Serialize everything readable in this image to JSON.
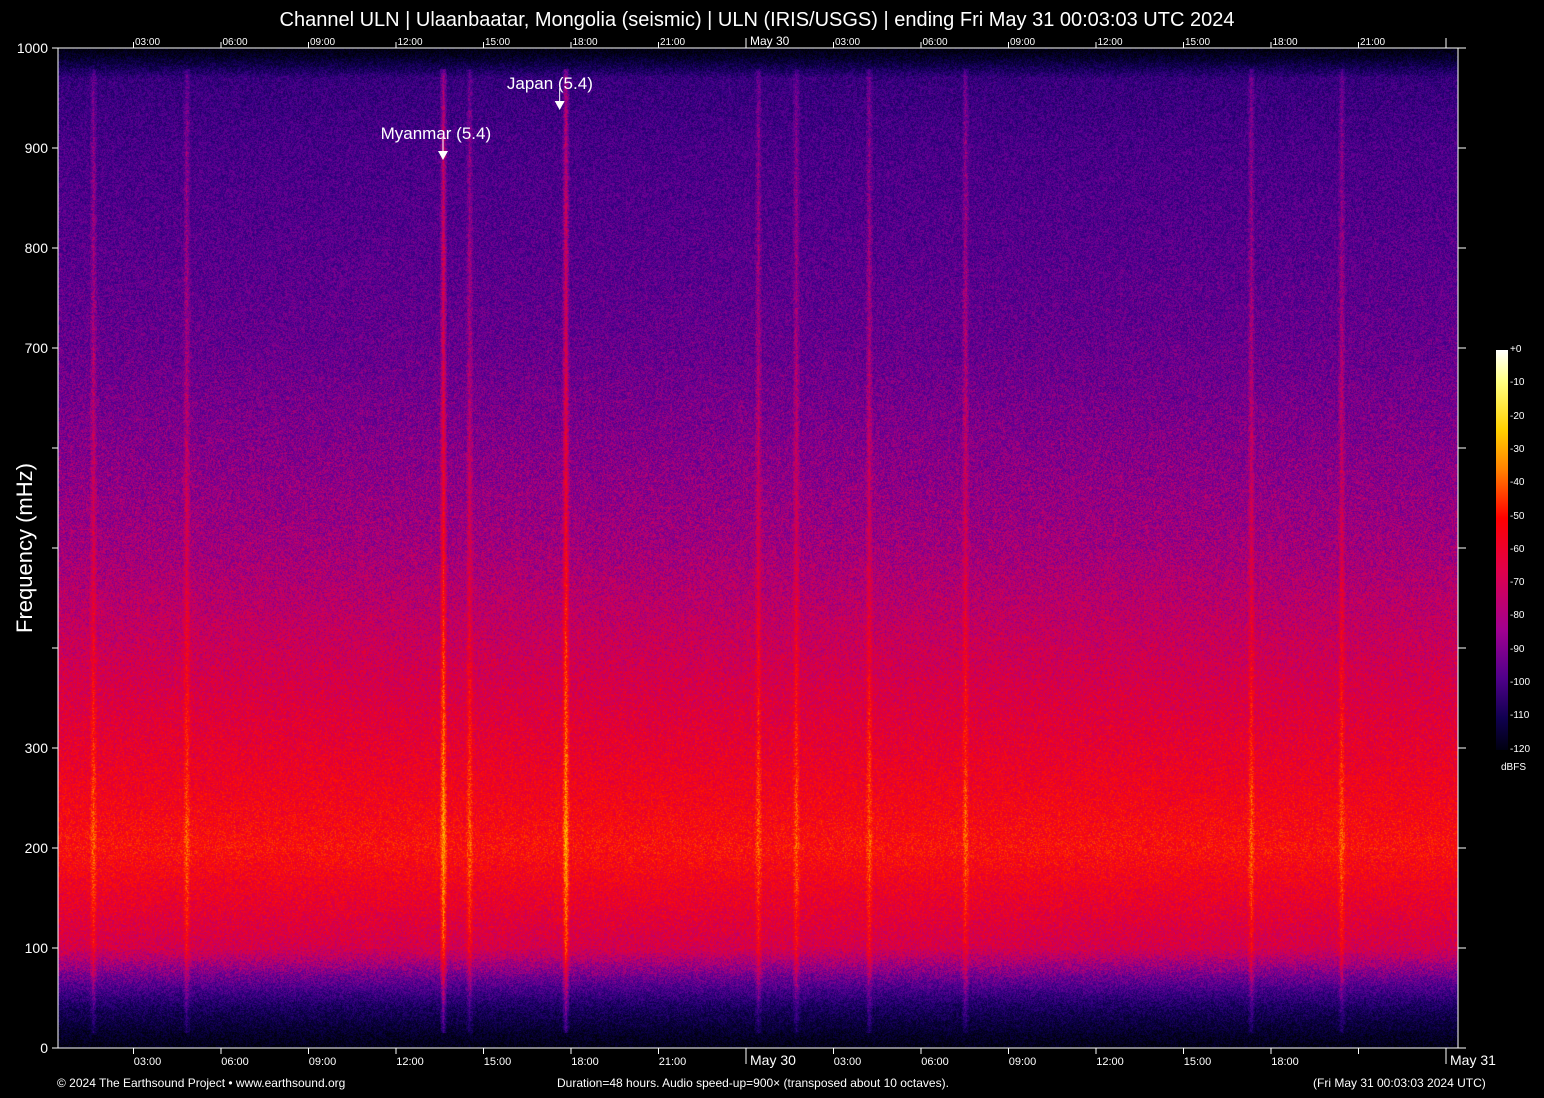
{
  "chart_data": {
    "type": "heatmap",
    "title": "Channel ULN | Ulaanbaatar, Mongolia (seismic) | ULN (IRIS/USGS) | ending Fri May 31 00:03:03 UTC 2024",
    "ylabel": "Frequency (mHz)",
    "ylim": [
      0,
      1000
    ],
    "y_ticks": [
      0,
      100,
      200,
      300,
      400,
      500,
      600,
      700,
      800,
      900,
      1000
    ],
    "y_tick_labels": [
      "0",
      "100",
      "200",
      "300",
      "",
      "",
      "",
      "700",
      "800",
      "900",
      "1000"
    ],
    "x_range_hours": [
      0,
      48
    ],
    "x_ticks_hours": [
      3,
      6,
      9,
      12,
      15,
      18,
      21,
      24,
      27,
      30,
      33,
      36,
      39,
      42,
      45,
      48
    ],
    "x_tick_labels_bottom": [
      "03:00",
      "06:00",
      "09:00",
      "12:00",
      "15:00",
      "18:00",
      "21:00",
      "May 30",
      "03:00",
      "06:00",
      "09:00",
      "12:00",
      "15:00",
      "18:00",
      "",
      "May 31"
    ],
    "x_tick_labels_top": [
      "03:00",
      "06:00",
      "09:00",
      "12:00",
      "15:00",
      "18:00",
      "21:00",
      "May 30",
      "03:00",
      "06:00",
      "09:00",
      "12:00",
      "15:00",
      "18:00",
      "21:00",
      ""
    ],
    "colorbar": {
      "label": "dBFS",
      "range": [
        -120,
        0
      ],
      "ticks": [
        "+0",
        "-10",
        "-20",
        "-30",
        "-40",
        "-50",
        "-60",
        "-70",
        "-80",
        "-90",
        "-100",
        "-110",
        "-120"
      ]
    },
    "annotations": [
      {
        "label": "Myanmar (5.4)",
        "hour": 13.2,
        "freq": 890
      },
      {
        "label": "Japan (5.4)",
        "hour": 17.2,
        "freq": 940
      }
    ],
    "events_hours": [
      1.2,
      4.4,
      13.2,
      14.1,
      17.4,
      24.0,
      25.3,
      27.8,
      31.1,
      40.9,
      44.0
    ],
    "background_profile": {
      "freq": [
        0,
        40,
        100,
        200,
        300,
        500,
        700,
        900,
        970,
        1000
      ],
      "dbfs": [
        -118,
        -100,
        -62,
        -48,
        -56,
        -72,
        -82,
        -88,
        -92,
        -120
      ]
    }
  },
  "footer": {
    "left": "© 2024 The Earthsound Project • www.earthsound.org",
    "center": "Duration=48 hours. Audio speed-up=900× (transposed about 10 octaves).",
    "right": "(Fri May 31 00:03:03 2024 UTC)"
  }
}
